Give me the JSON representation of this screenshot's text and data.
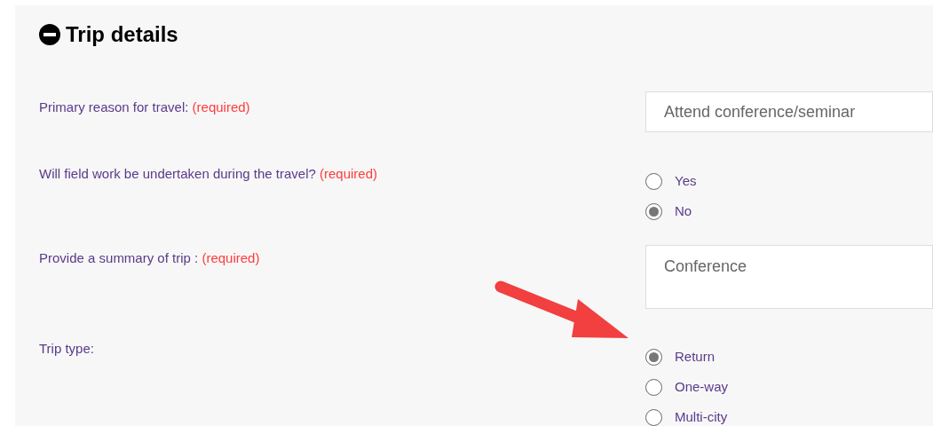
{
  "section": {
    "title": "Trip details",
    "expanded": true
  },
  "fields": [
    {
      "kind": "select",
      "label": "Primary reason for travel:",
      "required": "(required)",
      "value": "Attend conference/seminar"
    },
    {
      "kind": "radio",
      "label": "Will field work be undertaken during the travel?",
      "required": "(required)",
      "options": [
        {
          "label": "Yes",
          "selected": false
        },
        {
          "label": "No",
          "selected": true
        }
      ]
    },
    {
      "kind": "textarea",
      "label": "Provide a summary of trip :",
      "required": "(required)",
      "value": "Conference"
    },
    {
      "kind": "radio",
      "label": "Trip type:",
      "options": [
        {
          "label": "Return",
          "selected": true
        },
        {
          "label": "One-way",
          "selected": false
        },
        {
          "label": "Multi-city",
          "selected": false
        }
      ]
    }
  ]
}
